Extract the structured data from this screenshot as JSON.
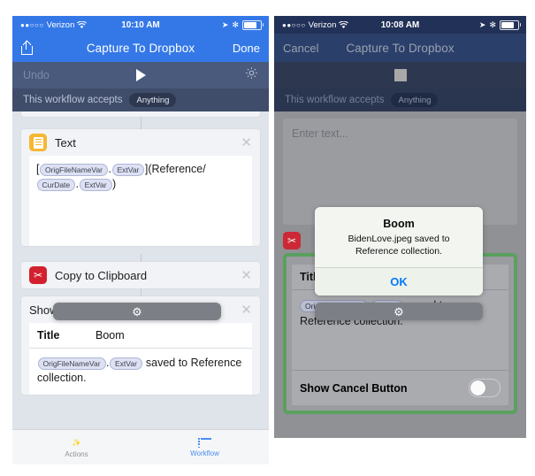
{
  "colors": {
    "nav_blue": "#3478e8",
    "nav_blue_dim": "#2b3f6b",
    "toolbar_slate": "#4a5a7d",
    "accept_slate": "#3f4d6b",
    "accent_blue": "#4a8ef0",
    "alert_link": "#007aff",
    "card_text_orange": "#f7b733",
    "card_clip_red": "#d3202f",
    "card_alert_grey": "#7c7f85",
    "highlight_green": "#5aa05e"
  },
  "left": {
    "status": {
      "dots": "●●○○○",
      "carrier": "Verizon",
      "wifi": "wifi-icon",
      "time": "10:10 AM",
      "location": "➤",
      "bluetooth": "✻"
    },
    "nav": {
      "share": "share-icon",
      "title": "Capture To Dropbox",
      "done": "Done"
    },
    "toolbar": {
      "undo": "Undo",
      "play": "play-icon",
      "settings": "gear-icon"
    },
    "accepts": {
      "label": "This workflow accepts",
      "value": "Anything"
    },
    "cards": [
      {
        "icon": "text-icon",
        "title": "Text",
        "close": "✕",
        "text_parts": [
          {
            "type": "plain",
            "value": "["
          },
          {
            "type": "token",
            "value": "OrigFileNameVar"
          },
          {
            "type": "plain",
            "value": "."
          },
          {
            "type": "token",
            "value": "ExtVar"
          },
          {
            "type": "plain",
            "value": "](Reference/"
          },
          {
            "type": "token",
            "value": "CurDate"
          },
          {
            "type": "plain",
            "value": "."
          },
          {
            "type": "token",
            "value": "ExtVar"
          },
          {
            "type": "plain",
            "value": ")"
          }
        ]
      },
      {
        "icon": "scissors-icon",
        "title": "Copy to Clipboard",
        "close": "✕"
      },
      {
        "icon": "gear-icon",
        "title": "Show Alert",
        "close": "✕",
        "title_field_key": "Title",
        "title_field_value": "Boom",
        "message_parts": [
          {
            "type": "token",
            "value": "OrigFileNameVar"
          },
          {
            "type": "plain",
            "value": "."
          },
          {
            "type": "token",
            "value": "ExtVar"
          },
          {
            "type": "plain",
            "value": " saved to Reference collection."
          }
        ]
      }
    ],
    "tabs": [
      {
        "icon": "magic-wand-icon",
        "label": "Actions",
        "active": false
      },
      {
        "icon": "workflow-list-icon",
        "label": "Workflow",
        "active": true
      }
    ]
  },
  "right": {
    "status": {
      "dots": "●●○○○",
      "carrier": "Verizon",
      "wifi": "wifi-icon",
      "time": "10:08 AM",
      "location": "➤",
      "bluetooth": "✻"
    },
    "nav": {
      "cancel": "Cancel",
      "title": "Capture To Dropbox"
    },
    "toolbar": {
      "stop": "stop-icon"
    },
    "accepts": {
      "label": "This workflow accepts",
      "value": "Anything"
    },
    "textfield_placeholder": "Enter text...",
    "cards": [
      {
        "icon": "scissors-icon"
      },
      {
        "icon": "gear-icon",
        "title_field_key": "Title",
        "title_field_value": "Boom",
        "message_parts": [
          {
            "type": "token",
            "value": "OrigFileNameVar"
          },
          {
            "type": "plain",
            "value": "."
          },
          {
            "type": "token",
            "value": "ExtVar"
          },
          {
            "type": "plain",
            "value": " saved to Reference collection."
          }
        ],
        "toggle_label": "Show Cancel Button",
        "toggle_on": false
      }
    ],
    "alert": {
      "title": "Boom",
      "message": "BidenLove.jpeg saved to Reference collection.",
      "ok": "OK"
    }
  }
}
